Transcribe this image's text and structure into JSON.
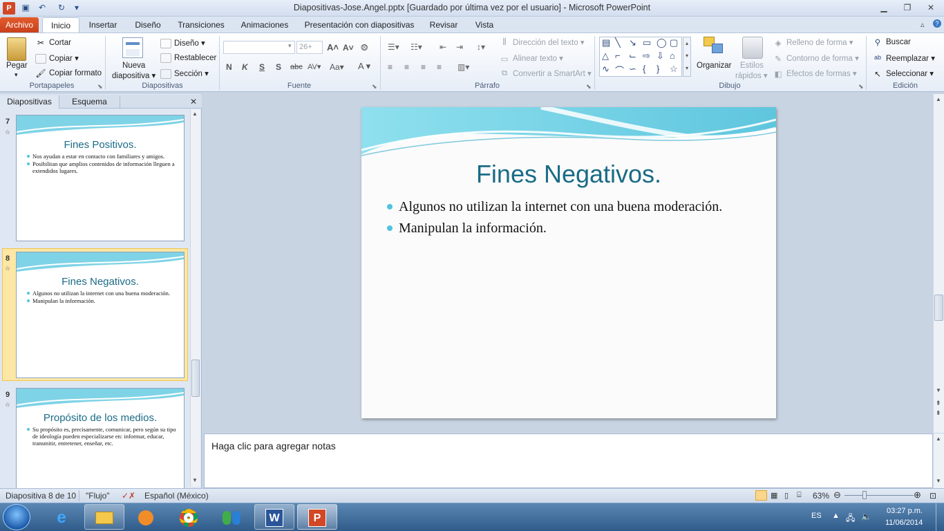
{
  "window": {
    "title": "Diapositivas-Jose.Angel.pptx [Guardado por última vez por el usuario]  -  Microsoft PowerPoint",
    "app_icon_letter": "P"
  },
  "tabs": {
    "file": "Archivo",
    "items": [
      "Inicio",
      "Insertar",
      "Diseño",
      "Transiciones",
      "Animaciones",
      "Presentación con diapositivas",
      "Revisar",
      "Vista"
    ]
  },
  "ribbon": {
    "clipboard": {
      "paste": "Pegar",
      "cut": "Cortar",
      "copy": "Copiar",
      "format_painter": "Copiar formato",
      "label": "Portapapeles"
    },
    "slides": {
      "new_slide_1": "Nueva",
      "new_slide_2": "diapositiva",
      "layout": "Diseño",
      "reset": "Restablecer",
      "section": "Sección",
      "label": "Diapositivas"
    },
    "font": {
      "size": "26+",
      "label": "Fuente"
    },
    "paragraph": {
      "text_direction": "Dirección del texto",
      "align_text": "Alinear texto",
      "smartart": "Convertir a SmartArt",
      "label": "Párrafo"
    },
    "drawing": {
      "arrange": "Organizar",
      "quick_styles_1": "Estilos",
      "quick_styles_2": "rápidos",
      "shape_fill": "Relleno de forma",
      "shape_outline": "Contorno de forma",
      "shape_effects": "Efectos de formas",
      "label": "Dibujo"
    },
    "editing": {
      "find": "Buscar",
      "replace": "Reemplazar",
      "select": "Seleccionar",
      "label": "Edición"
    }
  },
  "panel": {
    "tab_slides": "Diapositivas",
    "tab_outline": "Esquema",
    "thumbnails": [
      {
        "number": "7",
        "title": "Fines Positivos.",
        "bullets": [
          "Nos ayudan a estar en contacto con familiares y amigos.",
          "Posibilitan que amplios contenidos de información lleguen a extendidos lugares."
        ]
      },
      {
        "number": "8",
        "title": "Fines Negativos.",
        "bullets": [
          "Algunos no utilizan la internet con una buena moderación.",
          "Manipulan la información."
        ]
      },
      {
        "number": "9",
        "title": "Propósito de los medios.",
        "bullets": [
          "Su propósito  es, precisamente, comunicar, pero según su tipo de ideología pueden especializarse en: informar, educar, transmitir, entretener, enseñar, etc."
        ]
      }
    ]
  },
  "slide": {
    "title": "Fines Negativos.",
    "bullets": [
      "Algunos no utilizan la internet con una buena moderación.",
      "Manipulan la información."
    ]
  },
  "notes": {
    "placeholder": "Haga clic para agregar notas"
  },
  "status": {
    "slide_of": "Diapositiva 8 de 10",
    "theme": "\"Flujo\"",
    "language": "Español (México)",
    "zoom": "63%"
  },
  "taskbar": {
    "lang": "ES",
    "time": "03:27 p.m.",
    "date": "11/06/2014",
    "word_letter": "W",
    "ppt_letter": "P"
  },
  "colors": {
    "accent": "#1a6b86",
    "bullet": "#4fc3e0",
    "file_tab": "#d24726"
  }
}
